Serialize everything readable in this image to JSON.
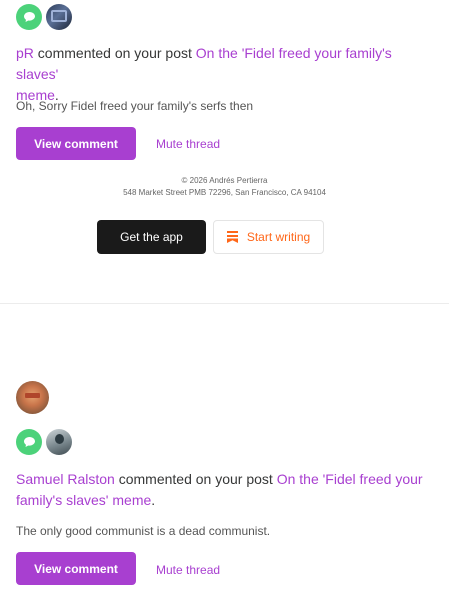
{
  "notifications": [
    {
      "author": "pR",
      "action": " commented on your post ",
      "post_title_line1": "On the 'Fidel freed your family's slaves'",
      "post_title_line2": "meme",
      "end_punct": ".",
      "comment": "Oh, Sorry Fidel freed your family's serfs then",
      "view_label": "View comment",
      "mute_label": "Mute thread"
    },
    {
      "author": "Samuel Ralston",
      "action": " commented on your post ",
      "post_title_line1": "On the 'Fidel freed your",
      "post_title_line2": "family's slaves' meme",
      "end_punct": ".",
      "comment": "The only good communist is a dead communist.",
      "view_label": "View comment",
      "mute_label": "Mute thread"
    }
  ],
  "footer": {
    "copyright": "© 2026 Andrés Pertierra",
    "address": "548 Market Street PMB 72296, San Francisco, CA 94104",
    "get_app_label": "Get the app",
    "start_writing_label": "Start writing"
  },
  "colors": {
    "accent": "#a83fd0",
    "comment_badge": "#4cd27a",
    "substack_orange": "#ff6719"
  },
  "icons": {
    "comment_badge": "speech-bubble-icon",
    "start_writing": "bookmark-icon"
  }
}
